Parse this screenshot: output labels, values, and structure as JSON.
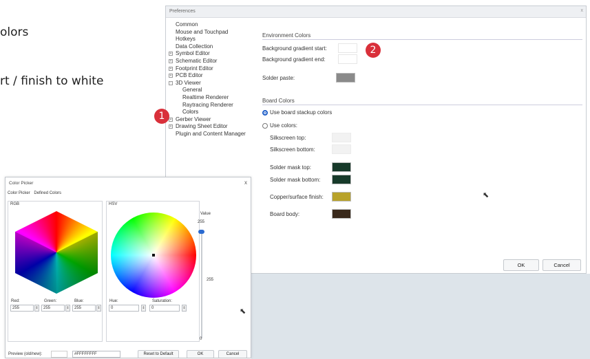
{
  "slide": {
    "text_line1": "olors",
    "text_line2": "rt / finish to white"
  },
  "badges": {
    "one": "1",
    "two": "2"
  },
  "preferences": {
    "title": "Preferences",
    "close": "x",
    "tree": [
      {
        "label": "Common",
        "level": 0,
        "expander": ""
      },
      {
        "label": "Mouse and Touchpad",
        "level": 0,
        "expander": ""
      },
      {
        "label": "Hotkeys",
        "level": 0,
        "expander": ""
      },
      {
        "label": "Data Collection",
        "level": 0,
        "expander": ""
      },
      {
        "label": "Symbol Editor",
        "level": 0,
        "expander": "+"
      },
      {
        "label": "Schematic Editor",
        "level": 0,
        "expander": "+"
      },
      {
        "label": "Footprint Editor",
        "level": 0,
        "expander": "+"
      },
      {
        "label": "PCB Editor",
        "level": 0,
        "expander": "+"
      },
      {
        "label": "3D Viewer",
        "level": 0,
        "expander": "-"
      },
      {
        "label": "General",
        "level": 1,
        "expander": ""
      },
      {
        "label": "Realtime Renderer",
        "level": 1,
        "expander": ""
      },
      {
        "label": "Raytracing Renderer",
        "level": 1,
        "expander": ""
      },
      {
        "label": "Colors",
        "level": 1,
        "expander": ""
      },
      {
        "label": "Gerber Viewer",
        "level": 0,
        "expander": "+"
      },
      {
        "label": "Drawing Sheet Editor",
        "level": 0,
        "expander": "+"
      },
      {
        "label": "Plugin and Content Manager",
        "level": 0,
        "expander": ""
      }
    ],
    "environment": {
      "heading": "Environment Colors",
      "bg_start_label": "Background gradient start:",
      "bg_end_label": "Background gradient end:",
      "solder_paste_label": "Solder paste:"
    },
    "board": {
      "heading": "Board Colors",
      "use_stackup": "Use board stackup colors",
      "use_colors": "Use colors:",
      "silk_top": "Silkscreen top:",
      "silk_bottom": "Silkscreen bottom:",
      "mask_top": "Solder mask top:",
      "mask_bottom": "Solder mask bottom:",
      "copper": "Copper/surface finish:",
      "body": "Board body:"
    },
    "buttons": {
      "ok": "OK",
      "cancel": "Cancel"
    },
    "colors": {
      "bg_start": "#ffffff",
      "bg_end": "#ffffff",
      "solder_paste": "#8a8a8a",
      "silk_top": "#f2f2f2",
      "silk_bottom": "#f2f2f2",
      "mask_top": "#173a2a",
      "mask_bottom": "#173a2a",
      "copper": "#b8a22a",
      "body": "#3a2a1c"
    }
  },
  "color_picker": {
    "title": "Color Picker",
    "close": "x",
    "tabs": [
      "Color Picker",
      "Defined Colors"
    ],
    "rgb_label": "RGB",
    "hsv_label": "HSV",
    "value_label": "Value",
    "value_top": "255",
    "value_mid": "255",
    "value_bottom": "0",
    "red_label": "Red:",
    "green_label": "Green:",
    "blue_label": "Blue:",
    "hue_label": "Hue:",
    "saturation_label": "Saturation:",
    "red": "255",
    "green": "255",
    "blue": "255",
    "hue": "0",
    "saturation": "0",
    "preview_label": "Preview (old/new):",
    "hex_value": "#FFFFFFFF",
    "reset_button": "Reset to Default",
    "ok_button": "OK",
    "cancel_button": "Cancel"
  }
}
